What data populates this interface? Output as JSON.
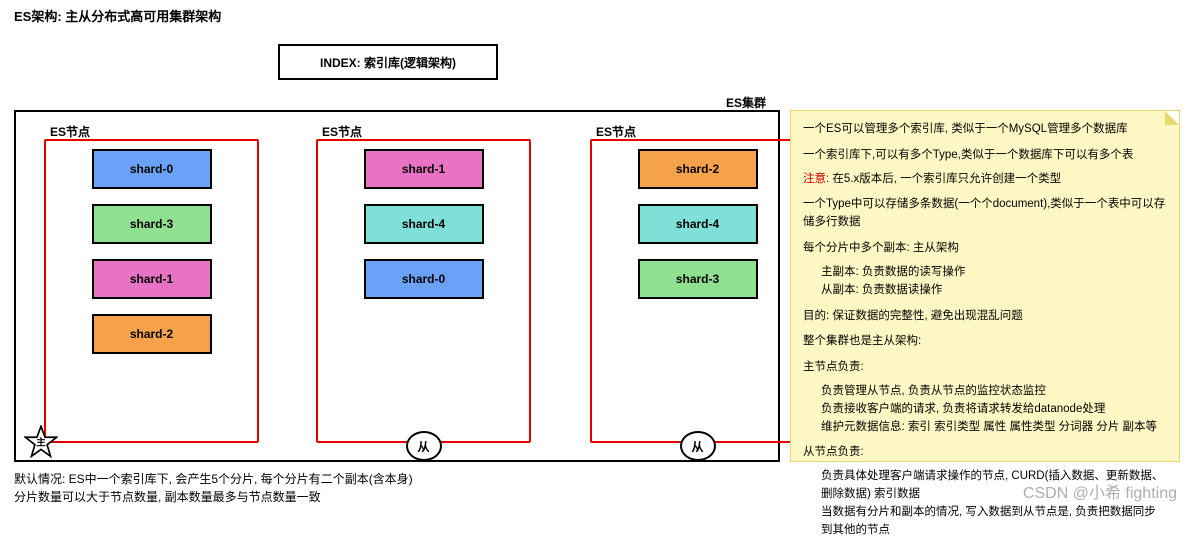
{
  "title": "ES架构: 主从分布式高可用集群架构",
  "index_box": "INDEX: 索引库(逻辑架构)",
  "cluster_label": "ES集群",
  "nodes": [
    {
      "label": "ES节点",
      "role": "主",
      "shards": [
        {
          "name": "shard-0",
          "color": "blue"
        },
        {
          "name": "shard-3",
          "color": "green"
        },
        {
          "name": "shard-1",
          "color": "pink"
        },
        {
          "name": "shard-2",
          "color": "orange"
        }
      ]
    },
    {
      "label": "ES节点",
      "role": "从",
      "shards": [
        {
          "name": "shard-1",
          "color": "pink"
        },
        {
          "name": "shard-4",
          "color": "cyan"
        },
        {
          "name": "shard-0",
          "color": "blue"
        }
      ]
    },
    {
      "label": "ES节点",
      "role": "从",
      "shards": [
        {
          "name": "shard-2",
          "color": "orange"
        },
        {
          "name": "shard-4",
          "color": "cyan"
        },
        {
          "name": "shard-3",
          "color": "green"
        }
      ]
    }
  ],
  "note": {
    "l1": "一个ES可以管理多个索引库, 类似于一个MySQL管理多个数据库",
    "l2a": "一个索引库下,可以有多个Type,类似于一个数据库下可以有多个表",
    "l2b_prefix": "注意:",
    "l2b": " 在5.x版本后, 一个索引库只允许创建一个类型",
    "l3": "一个Type中可以存储多条数据(一个个document),类似于一个表中可以存储多行数据",
    "l4a": "每个分片中多个副本: 主从架构",
    "l4b": "主副本: 负责数据的读写操作",
    "l4c": "从副本: 负责数据读操作",
    "l5": "目的: 保证数据的完整性, 避免出现混乱问题",
    "l6": "整个集群也是主从架构:",
    "l7a": "主节点负责:",
    "l7b": "负责管理从节点, 负责从节点的监控状态监控",
    "l7c": "负责接收客户端的请求, 负责将请求转发给datanode处理",
    "l7d": "维护元数据信息: 索引 索引类型 属性 属性类型 分词器 分片 副本等",
    "l8a": "从节点负责:",
    "l8b": "负责具体处理客户端请求操作的节点, CURD(插入数据、更新数据、删除数据) 索引数据",
    "l8c": "当数据有分片和副本的情况, 写入数据到从节点是, 负责把数据同步到其他的节点"
  },
  "footer": {
    "f1": "默认情况: ES中一个索引库下, 会产生5个分片, 每个分片有二个副本(含本身)",
    "f2": "分片数量可以大于节点数量, 副本数量最多与节点数量一致"
  },
  "watermark": "CSDN @小希 fighting"
}
